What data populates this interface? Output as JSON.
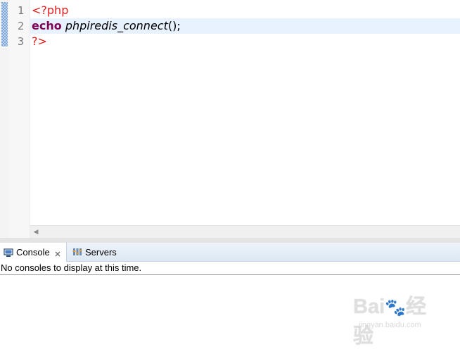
{
  "editor": {
    "line_numbers": [
      "1",
      "2",
      "3"
    ],
    "lines": [
      {
        "tag_open": "<?php"
      },
      {
        "keyword": "echo",
        "function": "phpiredis_connect",
        "punct": "();"
      },
      {
        "tag_close": "?>"
      }
    ]
  },
  "panel": {
    "tabs": [
      {
        "label": "Console",
        "icon": "console-icon",
        "active": true
      },
      {
        "label": "Servers",
        "icon": "servers-icon",
        "active": false
      }
    ],
    "message": "No consoles to display at this time."
  },
  "watermark": {
    "logo_text": "Bai经验",
    "url": "jingyan.baidu.com"
  },
  "colors": {
    "php_tag": "#e11c1c",
    "keyword": "#7f0055",
    "current_line": "#e8f2fe",
    "change_marker": "#7aa5d6"
  }
}
